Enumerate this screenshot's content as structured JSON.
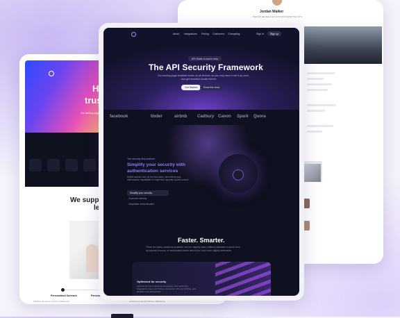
{
  "right_card": {
    "author_name": "Jordan Walker",
    "author_desc": "Frequent developer and community builder from NYC"
  },
  "center": {
    "nav": [
      "About",
      "Integrations",
      "Pricing",
      "Customers",
      "Changelog"
    ],
    "nav_signin": "Sign in",
    "nav_signup": "Sign up",
    "badge": "API Studio is now in beta",
    "hero_title": "The API Security Framework",
    "hero_sub_line1": "Our landing page template works on all devices, so you only have to set it up once,",
    "hero_sub_line2": "and get beautiful results forever.",
    "btn_primary": "Get Started",
    "btn_secondary": "Read the docs",
    "logos": [
      "facebook",
      "tinder",
      "airbnb",
      "Cadbury",
      "Canon",
      "Spark",
      "Quora"
    ],
    "feature_kicker": "The security first platform",
    "feature_title_line1": "Simplify your security with",
    "feature_title_line2": "authentication services",
    "feature_desc": "Define access roles for the end-users, and extend your authorization capabilities to implement dynamic access control.",
    "feature_items": [
      "Simplify your security",
      "Customer identity",
      "Adaptable authentication"
    ],
    "faster_title": "Faster. Smarter.",
    "faster_sub_line1": "There are many variations available, but the majority have suffered alteration in some form,",
    "faster_sub_line2": "by injected humour, or randomised words which don't look even slightly believable.",
    "optimized_title": "Optimized for security",
    "optimized_desc": "Optimize for user experience and privacy. Use social login integrations, lower user friction, incorporate rich user profiling, and facilitate more transactions."
  },
  "left_card": {
    "hero_line1": "Hir",
    "hero_line2": "trust",
    "hero_sub": "Our landing page te",
    "support_line1": "We suppo",
    "support_line2": "le",
    "step1_label": "Personalized Outreach",
    "step2_label": "Personaliz",
    "step_desc": "Find this as Jenny'd what to Salesforce"
  }
}
